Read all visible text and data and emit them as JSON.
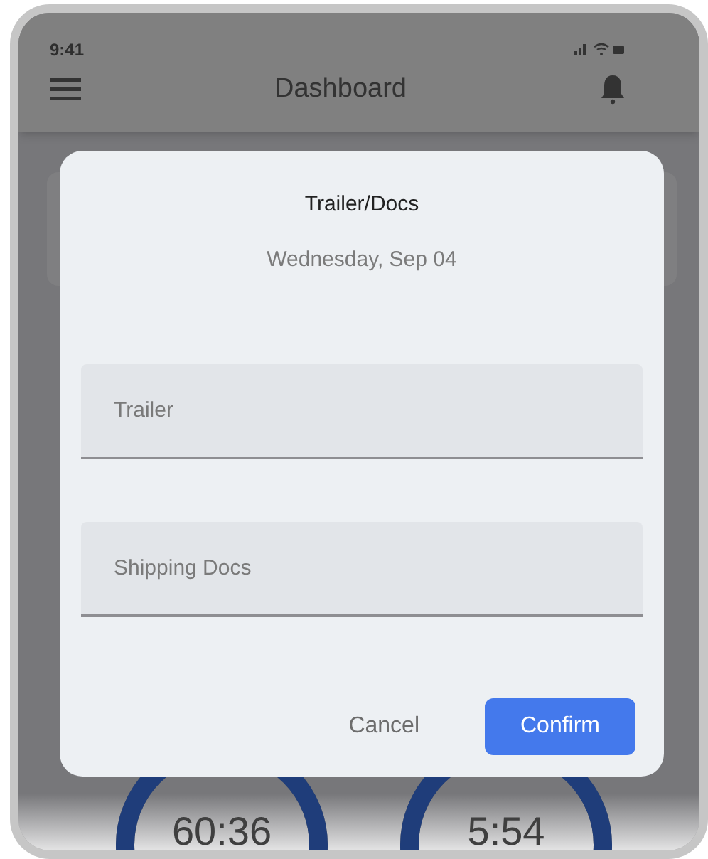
{
  "status_bar": {
    "time": "9:41"
  },
  "header": {
    "title": "Dashboard"
  },
  "timers": [
    {
      "reading": "60:36"
    },
    {
      "reading": "5:54"
    }
  ],
  "dialog": {
    "title": "Trailer/Docs",
    "date": "Wednesday, Sep 04",
    "fields": [
      {
        "placeholder": "Trailer"
      },
      {
        "placeholder": "Shipping Docs"
      }
    ],
    "buttons": [
      {
        "label": "Cancel",
        "kind": "text"
      },
      {
        "label": "Confirm",
        "kind": "primary"
      }
    ]
  }
}
